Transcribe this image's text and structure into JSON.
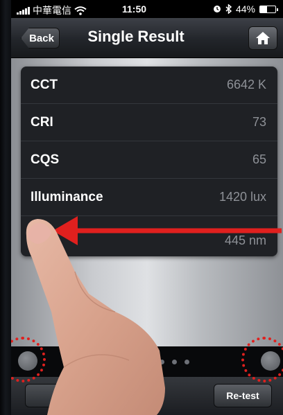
{
  "status_bar": {
    "carrier": "中華電信",
    "time": "11:50",
    "battery": "44%",
    "battery_level": 0.44
  },
  "nav": {
    "back_label": "Back",
    "title": "Single Result"
  },
  "results": [
    {
      "label": "CCT",
      "value": "6642 K"
    },
    {
      "label": "CRI",
      "value": "73"
    },
    {
      "label": "CQS",
      "value": "65"
    },
    {
      "label": "Illuminance",
      "value": "1420 lux"
    },
    {
      "label": "",
      "value": "445 nm"
    }
  ],
  "toolbar": {
    "retest_label": "Re-test"
  },
  "colors": {
    "annotation_red": "#e0201e"
  },
  "icons": [
    "signal-icon",
    "wifi-icon",
    "alarm-icon",
    "bluetooth-icon",
    "battery-icon",
    "home-icon"
  ]
}
